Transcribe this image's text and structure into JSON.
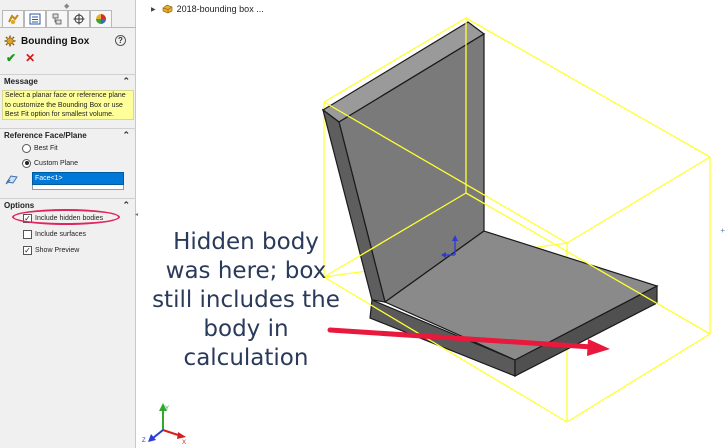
{
  "toolbar_tabs": [
    {
      "icon": "feature-manager-icon"
    },
    {
      "icon": "property-manager-icon"
    },
    {
      "icon": "configuration-manager-icon"
    },
    {
      "icon": "dimxpert-icon"
    },
    {
      "icon": "display-manager-icon"
    }
  ],
  "property_manager": {
    "title": "Bounding Box",
    "help": "?",
    "ok_symbol": "✔",
    "cancel_symbol": "✕",
    "message_section": {
      "header": "Message",
      "text": "Select a planar face or reference plane to customize the Bounding Box or use Best Fit option for smallest volume."
    },
    "reference_section": {
      "header": "Reference Face/Plane",
      "options": [
        {
          "label": "Best Fit",
          "selected": false
        },
        {
          "label": "Custom Plane",
          "selected": true
        }
      ],
      "selection_value": "Face<1>"
    },
    "options_section": {
      "header": "Options",
      "items": [
        {
          "label": "Include hidden bodies",
          "checked": true
        },
        {
          "label": "Include surfaces",
          "checked": false
        },
        {
          "label": "Show Preview",
          "checked": true
        }
      ]
    }
  },
  "graphics": {
    "tree_item": "2018-bounding box ...",
    "callout": "Hidden body was here; box still includes the body in calculation",
    "triad_labels": {
      "x": "X",
      "y": "Y",
      "z": "Z"
    },
    "colors": {
      "bounding_box": "#ffff33",
      "part_face": "#7a7a7a",
      "annotation_arrow": "#e8193c",
      "callout_text": "#2a3a5a"
    }
  }
}
